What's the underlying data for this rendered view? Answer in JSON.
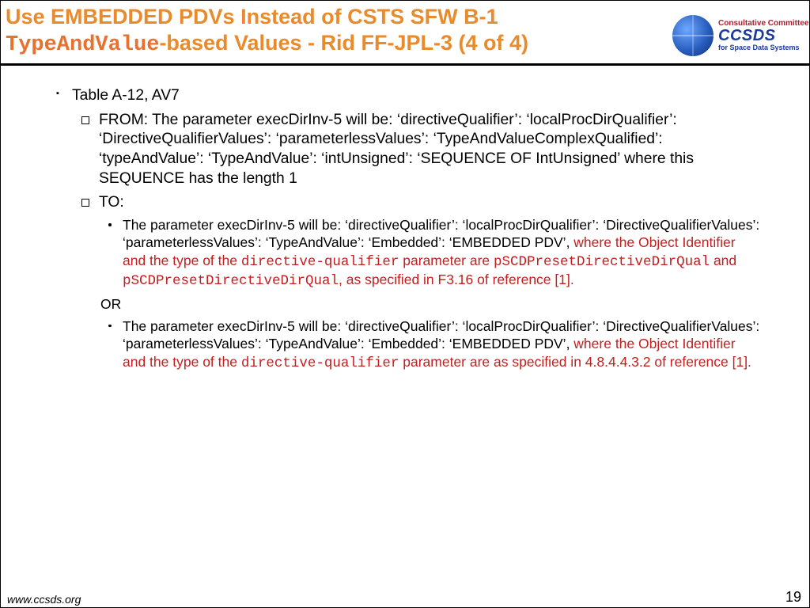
{
  "header": {
    "line1_pre": "Use EMBEDDED PDVs Instead of CSTS SFW B-1 ",
    "line2_code": "TypeAndValue",
    "line2_rest": "-based Values - Rid FF-JPL-3 (4 of 4)"
  },
  "logo": {
    "line1": "Consultative Committee",
    "brand": "CCSDS",
    "line2": "for Space Data Systems"
  },
  "content": {
    "item1": "Table A-12, AV7",
    "from_label": "FROM: ",
    "from_text": "The parameter execDirInv-5 will be: ‘directiveQualifier’: ‘localProcDirQualifier’: ‘DirectiveQualifierValues’: ‘parameterlessValues’: ‘TypeAndValueComplexQualified’: ‘typeAndValue’: ‘TypeAndValue’: ‘intUnsigned’: ‘SEQUENCE OF IntUnsigned’ where this SEQUENCE has the length 1",
    "to_label": "TO:",
    "to1_black": "The parameter execDirInv-5 will be: ‘directiveQualifier’: ‘localProcDirQualifier’: ‘DirectiveQualifierValues’: ‘parameterlessValues’: ‘TypeAndValue’: ‘Embedded’: ‘EMBEDDED PDV’, ",
    "to1_r1": "where the Object Identifier and the type of the ",
    "to1_m1": "directive-qualifier",
    "to1_r2": " parameter are ",
    "to1_m2": "pSCDPresetDirectiveDirQual",
    "to1_r3": " and ",
    "to1_m3": "pSCDPresetDirectiveDirQual",
    "to1_r4": ", as specified in F3.16 of reference [1].",
    "or_label": "OR",
    "to2_black": "The parameter execDirInv-5 will be: ‘directiveQualifier’: ‘localProcDirQualifier’: ‘DirectiveQualifierValues’: ‘parameterlessValues’: ‘TypeAndValue’: ‘Embedded’: ‘EMBEDDED PDV’, ",
    "to2_r1": "where the Object Identifier and the type of the ",
    "to2_m1": "directive-qualifier",
    "to2_r2": " parameter are as specified in 4.8.4.4.3.2 of reference [1]."
  },
  "footer": {
    "url": "www.ccsds.org",
    "page": "19"
  }
}
